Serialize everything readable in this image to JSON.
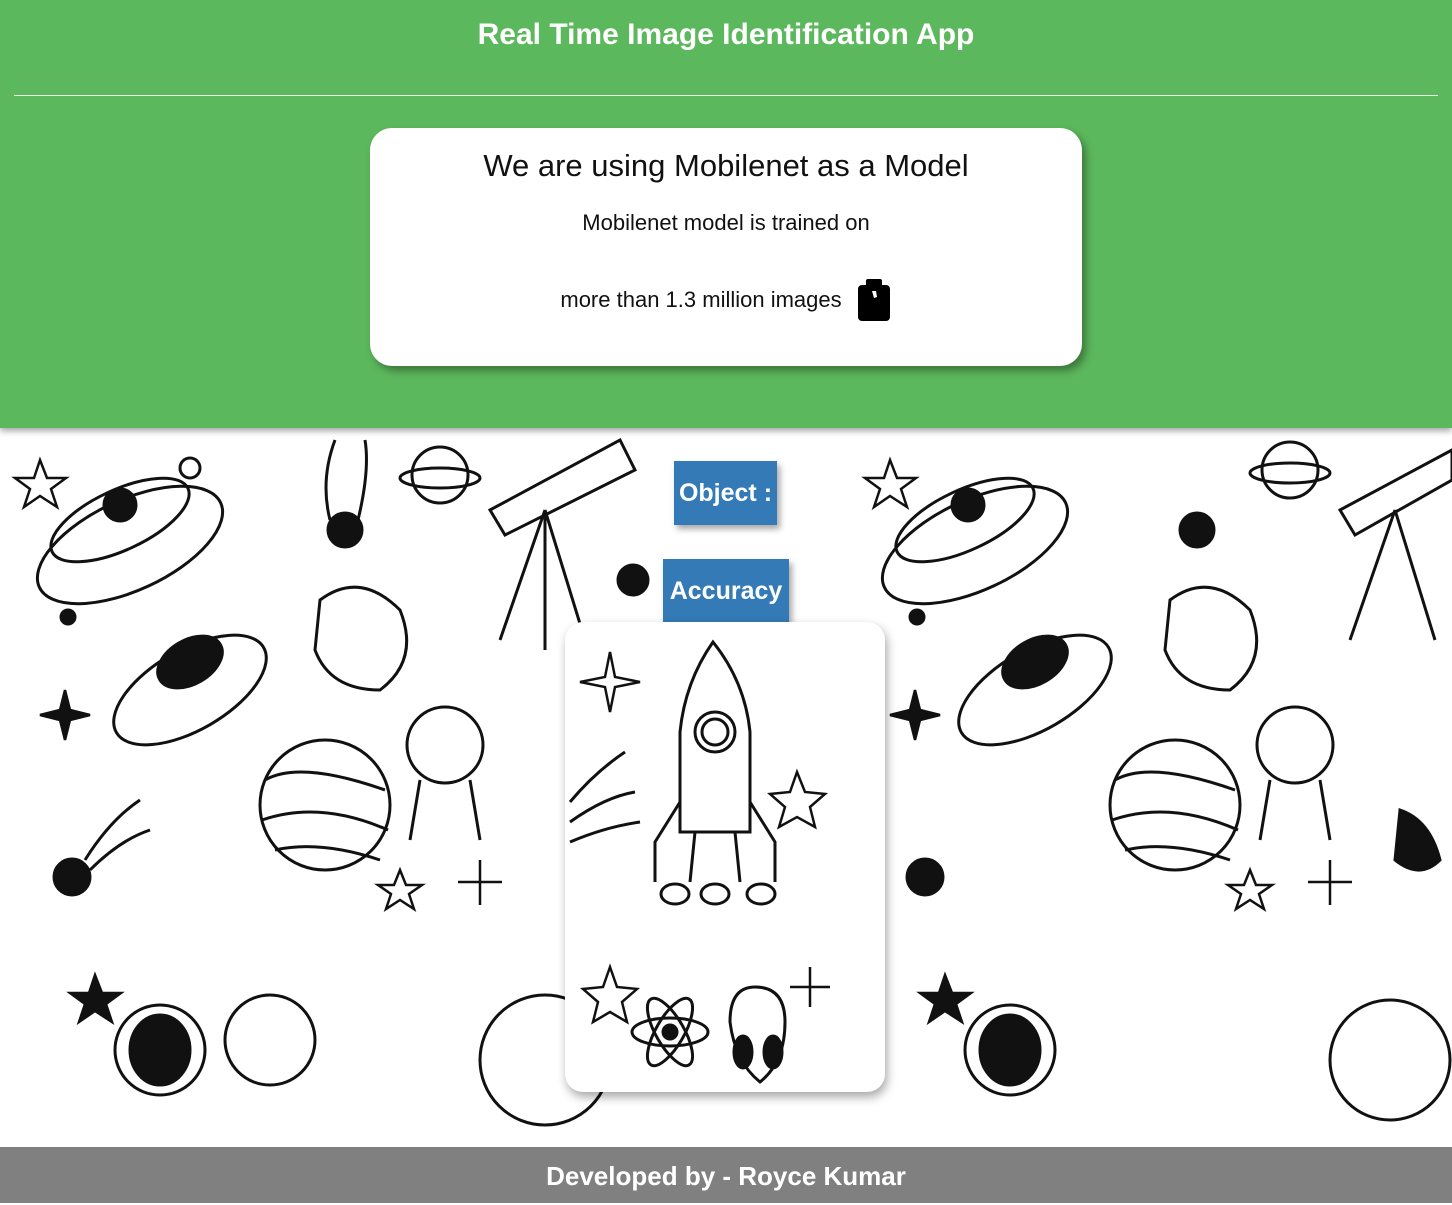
{
  "header": {
    "title": "Real Time Image Identification App"
  },
  "info_card": {
    "title": "We are using Mobilenet as a Model",
    "line1": "Mobilenet model is trained on",
    "line2": "more than 1.3 million images",
    "icon": "camera-icon"
  },
  "results": {
    "object_label": "Object :",
    "accuracy_label": "Accuracy :"
  },
  "footer": {
    "text": "Developed by - Royce Kumar"
  },
  "colors": {
    "header_bg": "#5cb85c",
    "button_bg": "#337ab7",
    "footer_bg": "#808080"
  }
}
